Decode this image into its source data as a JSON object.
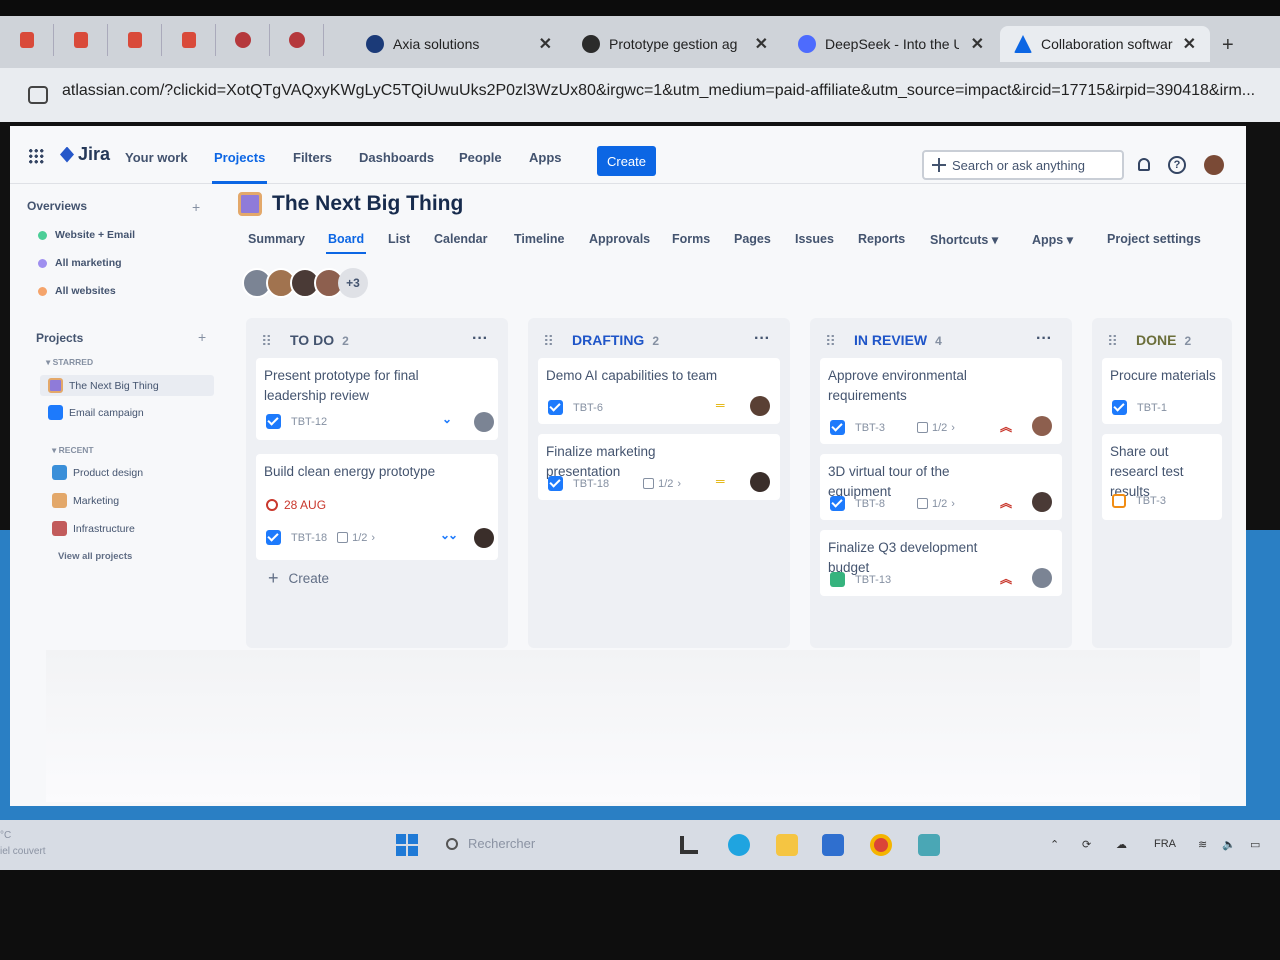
{
  "browser": {
    "tabs": [
      {
        "title": "Axia solutions",
        "color": "#1b3a78"
      },
      {
        "title": "Prototype gestion ag",
        "color": "#2b2b2b"
      },
      {
        "title": "DeepSeek - Into the U",
        "color": "#4d6bfe"
      },
      {
        "title": "Collaboration softwar",
        "color": "#0c66e4"
      }
    ],
    "url": "atlassian.com/?clickid=XotQTgVAQxyKWgLyC5TQiUwuUks2P0zl3WzUx80&irgwc=1&utm_medium=paid-affiliate&utm_source=impact&ircid=17715&irpid=390418&irm..."
  },
  "nav": {
    "logo": "Jira",
    "items": [
      "Your work",
      "Projects",
      "Filters",
      "Dashboards",
      "People",
      "Apps"
    ],
    "create": "Create",
    "search_placeholder": "Search or ask anything",
    "accent": "#0c66e4"
  },
  "sidebar": {
    "overviews_label": "Overviews",
    "overviews": [
      {
        "label": "Website + Email",
        "color": "#4bce97"
      },
      {
        "label": "All marketing",
        "color": "#9f8fef"
      },
      {
        "label": "All websites",
        "color": "#f5a46b"
      }
    ],
    "projects_label": "Projects",
    "starred_label": "STARRED",
    "starred": [
      "The Next Big Thing",
      "Email campaign"
    ],
    "recent_label": "RECENT",
    "recent": [
      "Product design",
      "Marketing",
      "Infrastructure"
    ],
    "view_all": "View all projects"
  },
  "project": {
    "title": "The Next Big Thing",
    "tabs": [
      "Summary",
      "Board",
      "List",
      "Calendar",
      "Timeline",
      "Approvals",
      "Forms",
      "Pages",
      "Issues",
      "Reports",
      "Shortcuts",
      "Apps",
      "Project settings"
    ],
    "active_tab": "Board",
    "extra_people": "+3"
  },
  "board": {
    "columns": [
      {
        "name": "TO DO",
        "count": "2",
        "cards": [
          {
            "title": "Present prototype for final leadership review",
            "key": "TBT-12"
          },
          {
            "title": "Build clean energy prototype",
            "due": "28 AUG",
            "key": "TBT-18",
            "subtasks": "1/2"
          }
        ],
        "create": "Create"
      },
      {
        "name": "DRAFTING",
        "count": "2",
        "cards": [
          {
            "title": "Demo AI capabilities to team",
            "key": "TBT-6"
          },
          {
            "title": "Finalize marketing presentation",
            "key": "TBT-18",
            "subtasks": "1/2"
          }
        ]
      },
      {
        "name": "IN REVIEW",
        "count": "4",
        "cards": [
          {
            "title": "Approve environmental requirements",
            "key": "TBT-3",
            "subtasks": "1/2"
          },
          {
            "title": "3D virtual tour of the equipment",
            "key": "TBT-8",
            "subtasks": "1/2"
          },
          {
            "title": "Finalize Q3 development budget",
            "key": "TBT-13"
          }
        ]
      },
      {
        "name": "DONE",
        "count": "2",
        "cards": [
          {
            "title": "Procure materials",
            "key": "TBT-1"
          },
          {
            "title": "Share out researcl test results",
            "key": "TBT-3"
          }
        ]
      }
    ]
  },
  "taskbar": {
    "weather_temp": "°C",
    "weather_desc": "iel couvert",
    "search": "Rechercher",
    "lang": "FRA"
  }
}
